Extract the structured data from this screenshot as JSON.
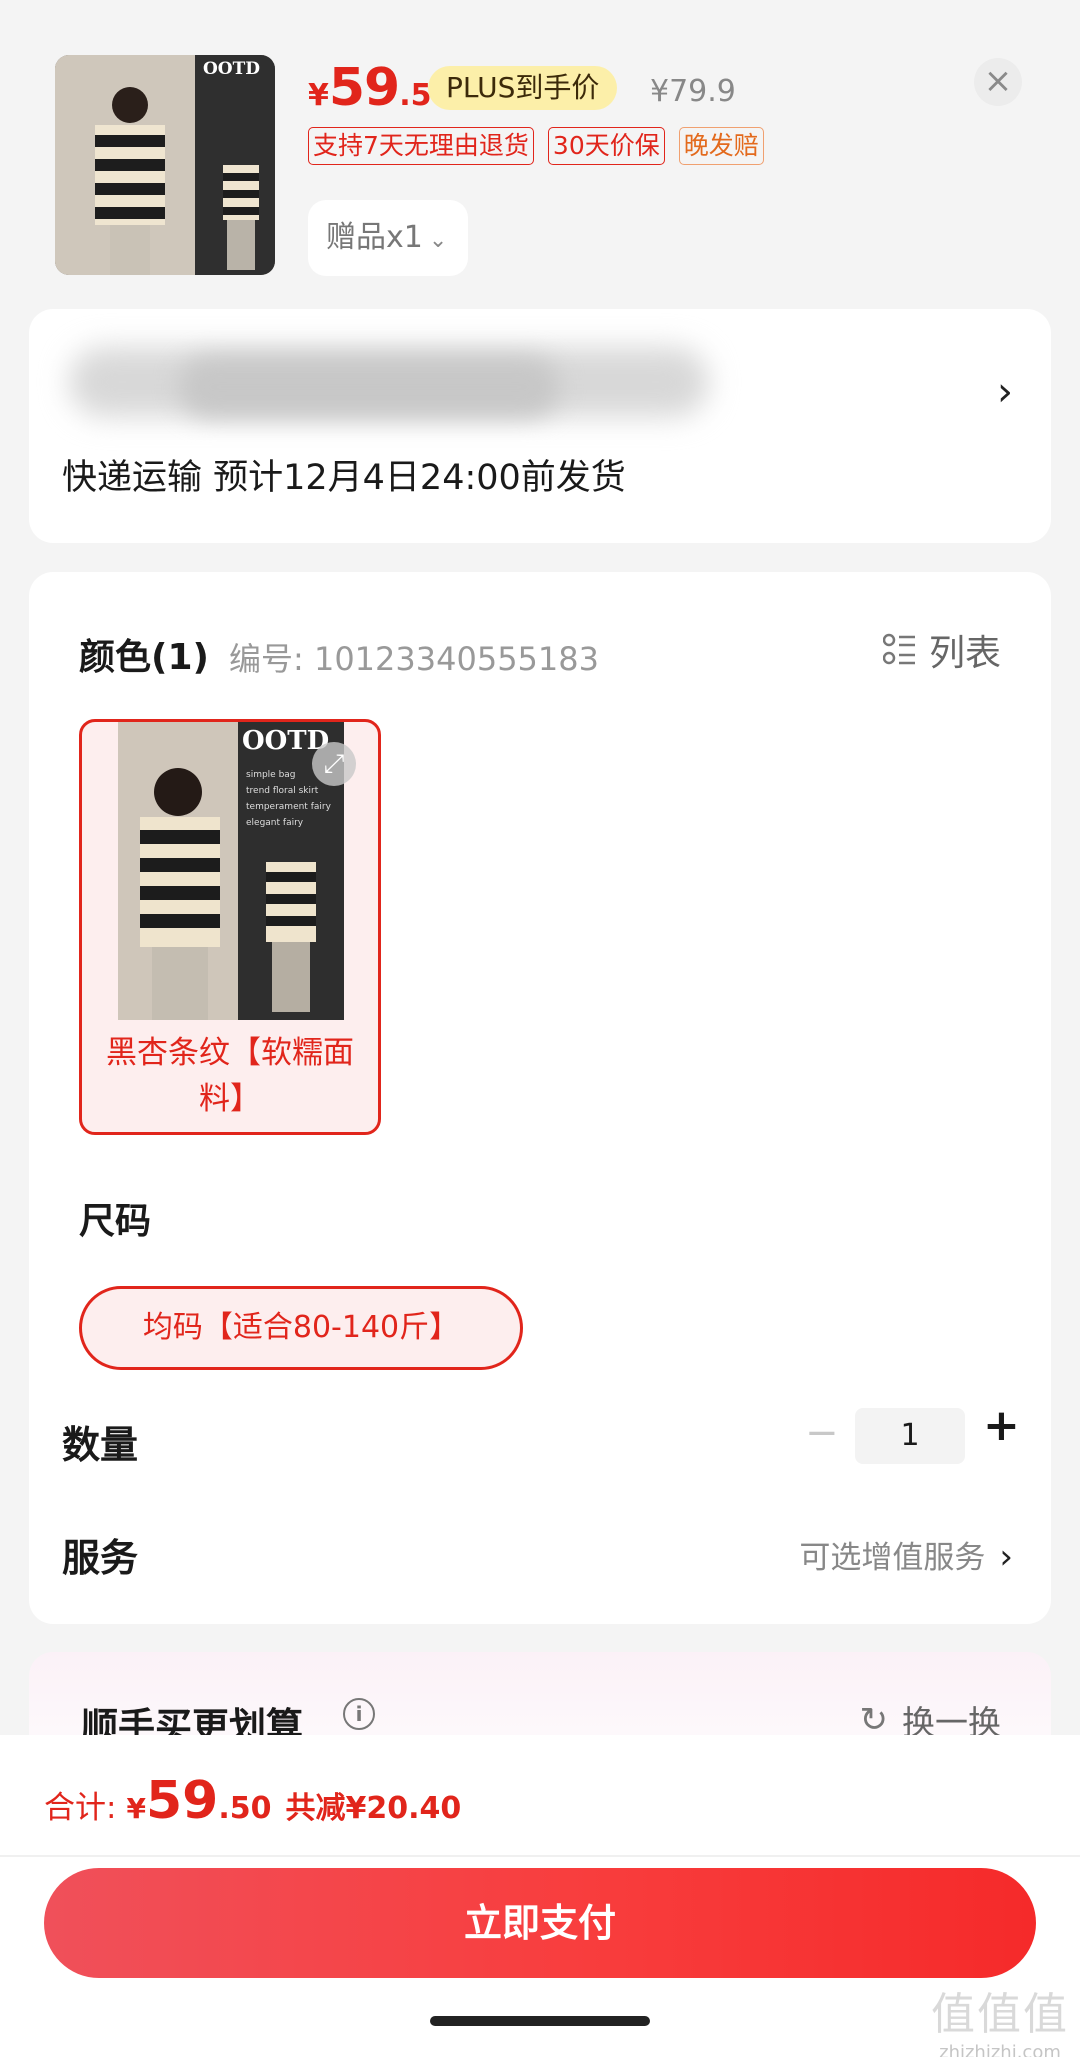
{
  "header": {
    "price": {
      "currency": "¥",
      "integer": "59",
      "decimal": ".5"
    },
    "plus_badge": "PLUS到手价",
    "original_price": "¥79.9",
    "close_icon": "×",
    "tags": [
      "支持7天无理由退货",
      "30天价保",
      "晚发赔"
    ],
    "gift": {
      "label": "赠品x1",
      "chevron": "⌄"
    }
  },
  "product_image": {
    "brand_text": "OOTD",
    "captions": [
      "simple bag",
      "trend floral skirt",
      "temperament fairy",
      "elegant fairy"
    ]
  },
  "address": {
    "chevron": "›",
    "shipping": "快递运输 预计12月4日24:00前发货"
  },
  "spec": {
    "color_title": "颜色(1)",
    "sku": "编号: 10123340555183",
    "list_toggle": "列表",
    "color_option": "黑杏条纹【软糯面料】",
    "size_title": "尺码",
    "size_option": "均码【适合80-140斤】",
    "quantity_title": "数量",
    "quantity_minus": "−",
    "quantity_value": "1",
    "quantity_plus": "+",
    "service_title": "服务",
    "service_value": "可选增值服务",
    "service_chevron": "›"
  },
  "bundle": {
    "title": "顺手买更划算",
    "info_icon": "i",
    "refresh_label": "换一换",
    "refresh_icon": "↻"
  },
  "footer": {
    "total_label": "合计:",
    "total_currency": "¥",
    "total_integer": "59",
    "total_decimal": ".50",
    "savings": "共减¥20.40",
    "pay_button": "立即支付"
  },
  "watermark": {
    "glyphs": "值值值",
    "domain": "zhizhizhi.com"
  },
  "colors": {
    "accent": "#e1251b",
    "plus_badge_bg": "#fcefa9",
    "card_bg": "#ffffff",
    "page_bg": "#f4f4f4"
  }
}
